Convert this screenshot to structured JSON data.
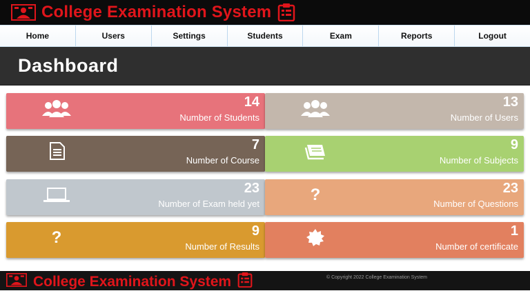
{
  "app": {
    "title": "College Examination System",
    "footer_title": "College Examination System",
    "copyright": "© Copyright 2022 College Examination System"
  },
  "nav": {
    "items": [
      {
        "label": "Home"
      },
      {
        "label": "Users"
      },
      {
        "label": "Settings"
      },
      {
        "label": "Students"
      },
      {
        "label": "Exam"
      },
      {
        "label": "Reports"
      },
      {
        "label": "Logout"
      }
    ]
  },
  "header": {
    "title": "Dashboard"
  },
  "stats": [
    {
      "value": "14",
      "label": "Number of Students",
      "color": "#e7737b",
      "icon": "users-icon"
    },
    {
      "value": "13",
      "label": "Number of Users",
      "color": "#c3b7ac",
      "icon": "users-icon"
    },
    {
      "value": "7",
      "label": "Number of Course",
      "color": "#766456",
      "icon": "document-icon"
    },
    {
      "value": "9",
      "label": "Number of Subjects",
      "color": "#a8d171",
      "icon": "book-icon"
    },
    {
      "value": "23",
      "label": "Number of Exam held yet",
      "color": "#c0c7cd",
      "icon": "laptop-icon"
    },
    {
      "value": "23",
      "label": "Number of Questions",
      "color": "#e8a77c",
      "icon": "question-icon"
    },
    {
      "value": "9",
      "label": "Number of Results",
      "color": "#d99a2f",
      "icon": "question-icon"
    },
    {
      "value": "1",
      "label": "Number of certificate",
      "color": "#e2805f",
      "icon": "badge-icon"
    }
  ],
  "colors": {
    "brand_red": "#e0151b",
    "topbar": "#0b0b0b",
    "header": "#2f2f2f"
  }
}
